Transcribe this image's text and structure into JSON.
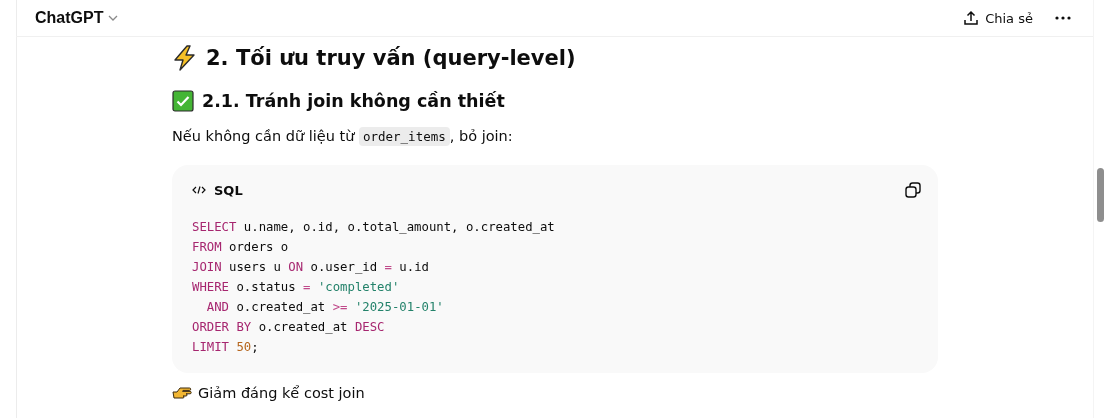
{
  "header": {
    "title": "ChatGPT",
    "share_label": "Chia sẻ"
  },
  "heading": {
    "text": "2. Tối ưu truy vấn (query-level)"
  },
  "subheading": {
    "text": "2.1. Tránh join không cần thiết"
  },
  "paragraph": [
    {
      "kind": "text",
      "text": "Nếu không cần dữ liệu từ "
    },
    {
      "kind": "code",
      "text": "order_items"
    },
    {
      "kind": "text",
      "text": ", bỏ join:"
    }
  ],
  "code_block": {
    "language": "SQL",
    "lines": [
      [
        {
          "kind": "keyword",
          "text": "SELECT"
        },
        {
          "kind": "plain",
          "text": " u.name, o.id, o.total_amount, o.created_at"
        }
      ],
      [
        {
          "kind": "keyword",
          "text": "FROM"
        },
        {
          "kind": "plain",
          "text": " orders o"
        }
      ],
      [
        {
          "kind": "keyword",
          "text": "JOIN"
        },
        {
          "kind": "plain",
          "text": " users u "
        },
        {
          "kind": "keyword",
          "text": "ON"
        },
        {
          "kind": "plain",
          "text": " o.user_id "
        },
        {
          "kind": "operator",
          "text": "="
        },
        {
          "kind": "plain",
          "text": " u.id"
        }
      ],
      [
        {
          "kind": "keyword",
          "text": "WHERE"
        },
        {
          "kind": "plain",
          "text": " o.status "
        },
        {
          "kind": "operator",
          "text": "="
        },
        {
          "kind": "string",
          "text": " 'completed'"
        }
      ],
      [
        {
          "kind": "keyword",
          "text": "  AND"
        },
        {
          "kind": "plain",
          "text": " o.created_at "
        },
        {
          "kind": "operator",
          "text": ">="
        },
        {
          "kind": "string",
          "text": " '2025-01-01'"
        }
      ],
      [
        {
          "kind": "keyword",
          "text": "ORDER BY"
        },
        {
          "kind": "plain",
          "text": " o.created_at "
        },
        {
          "kind": "keyword",
          "text": "DESC"
        }
      ],
      [
        {
          "kind": "keyword",
          "text": "LIMIT"
        },
        {
          "kind": "number",
          "text": " 50"
        },
        {
          "kind": "plain",
          "text": ";"
        }
      ]
    ]
  },
  "note": {
    "text": "Giảm đáng kể cost join"
  }
}
